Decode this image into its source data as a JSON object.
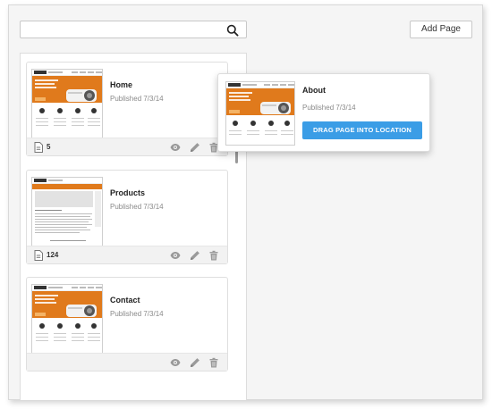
{
  "header": {
    "search_placeholder": "",
    "add_page_label": "Add Page"
  },
  "pages": [
    {
      "title": "Home",
      "status": "Published 7/3/14",
      "count": "5",
      "thumbnail": "home-template"
    },
    {
      "title": "Products",
      "status": "Published 7/3/14",
      "count": "124",
      "thumbnail": "products-template"
    },
    {
      "title": "Contact",
      "status": "Published 7/3/14",
      "count": "",
      "thumbnail": "home-template"
    }
  ],
  "dragging": {
    "title": "About",
    "status": "Published 7/3/14",
    "button_label": "DRAG PAGE INTO LOCATION"
  },
  "icons": {
    "search": "search-icon",
    "document": "document-icon",
    "view": "eye-icon",
    "edit": "pencil-icon",
    "delete": "trash-icon"
  },
  "colors": {
    "accent": "#3b9de6",
    "thumbnail_orange": "#e07a1c",
    "muted_text": "#8a8a8a",
    "footer_bg": "#f2f2f2"
  }
}
